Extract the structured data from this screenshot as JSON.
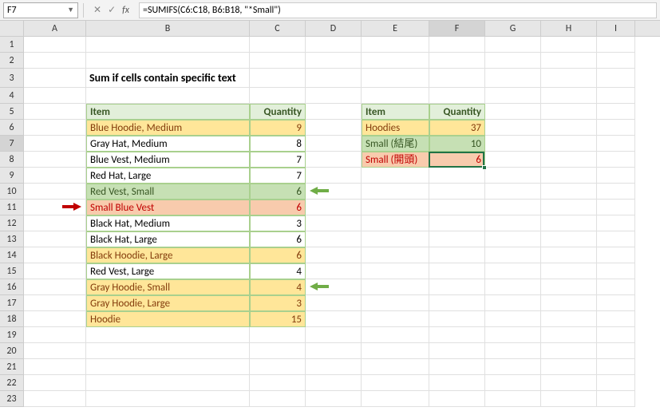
{
  "namebox": "F7",
  "formula": "=SUMIFS(C6:C18, B6:B18, \"*Small\")",
  "columns": [
    "A",
    "B",
    "C",
    "D",
    "E",
    "F",
    "G",
    "H",
    "I"
  ],
  "title": "Sum if cells contain specific text",
  "headers": {
    "item": "Item",
    "qty": "Quantity"
  },
  "table1": [
    {
      "item": "Blue Hoodie, Medium",
      "qty": "9",
      "cls": "fill-yellow"
    },
    {
      "item": "Gray Hat, Medium",
      "qty": "8",
      "cls": ""
    },
    {
      "item": "Blue Vest, Medium",
      "qty": "7",
      "cls": ""
    },
    {
      "item": "Red Hat, Large",
      "qty": "7",
      "cls": ""
    },
    {
      "item": "Red Vest, Small",
      "qty": "6",
      "cls": "fill-green"
    },
    {
      "item": "Small Blue Vest",
      "qty": "6",
      "cls": "fill-pink"
    },
    {
      "item": "Black Hat, Medium",
      "qty": "3",
      "cls": ""
    },
    {
      "item": "Black Hat, Large",
      "qty": "6",
      "cls": ""
    },
    {
      "item": "Black Hoodie, Large",
      "qty": "6",
      "cls": "fill-yellow"
    },
    {
      "item": "Red Vest, Large",
      "qty": "4",
      "cls": ""
    },
    {
      "item": "Gray Hoodie, Small",
      "qty": "4",
      "cls": "fill-yellow"
    },
    {
      "item": "Gray Hoodie, Large",
      "qty": "3",
      "cls": "fill-yellow"
    },
    {
      "item": "Hoodie",
      "qty": "15",
      "cls": "fill-yellow"
    }
  ],
  "table2": [
    {
      "item": "Hoodies",
      "qty": "37",
      "cls": "fill-yellow"
    },
    {
      "item": "Small (結尾)",
      "qty": "10",
      "cls": "fill-green"
    },
    {
      "item": "Small (開頭)",
      "qty": "6",
      "cls": "fill-pink"
    }
  ],
  "icons": {
    "cancel": "✕",
    "confirm": "✓",
    "fx": "fx"
  }
}
